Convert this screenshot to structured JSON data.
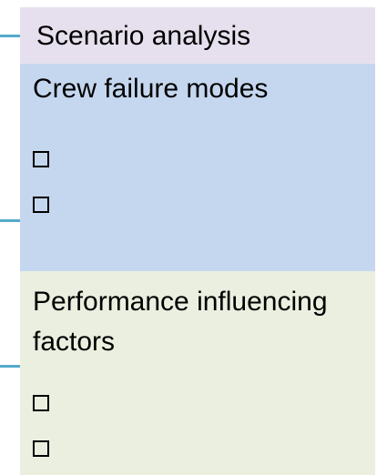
{
  "scenario": {
    "title": "Scenario analysis"
  },
  "crew": {
    "title": "Crew failure modes",
    "items": [
      "",
      ""
    ]
  },
  "pif": {
    "title": "Performance influencing factors",
    "items": [
      "",
      ""
    ]
  },
  "colors": {
    "scenario_bg": "#e6e0ee",
    "crew_bg": "#c5d7ef",
    "pif_bg": "#eaefdf",
    "connector": "#55aacb"
  }
}
